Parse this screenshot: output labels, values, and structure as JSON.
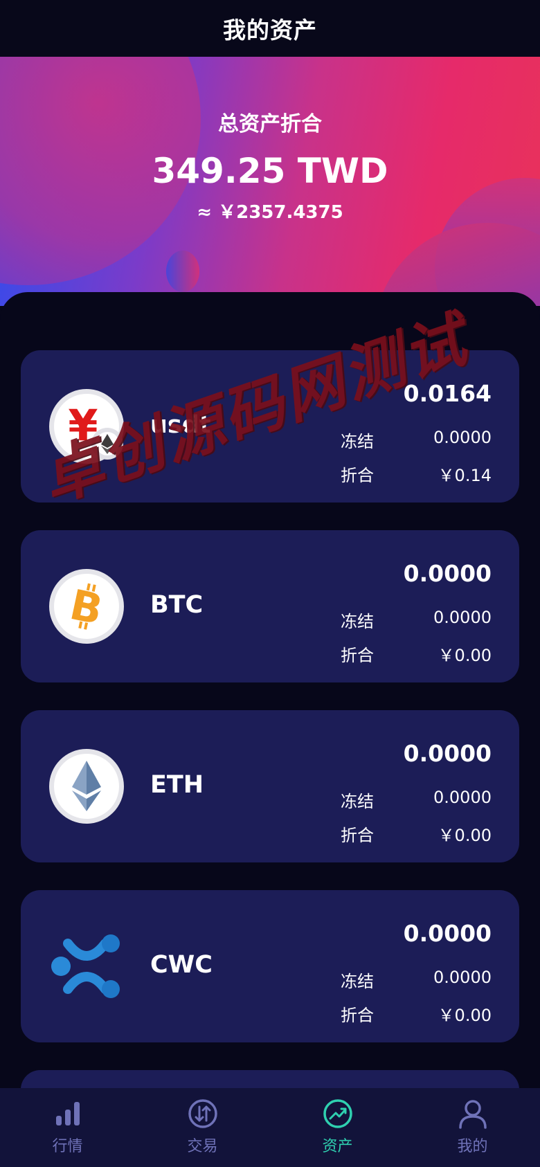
{
  "header": {
    "title": "我的资产"
  },
  "summary": {
    "label": "总资产折合",
    "total": "349.25 TWD",
    "approx": "≈ ￥2357.4375"
  },
  "assets": [
    {
      "name": "usdt",
      "amount": "0.0164",
      "frozen_label": "冻结",
      "frozen_value": "0.0000",
      "convert_label": "折合",
      "convert_value": "￥0.14",
      "icon": "usdt-yen-icon"
    },
    {
      "name": "BTC",
      "amount": "0.0000",
      "frozen_label": "冻结",
      "frozen_value": "0.0000",
      "convert_label": "折合",
      "convert_value": "￥0.00",
      "icon": "bitcoin-icon"
    },
    {
      "name": "ETH",
      "amount": "0.0000",
      "frozen_label": "冻结",
      "frozen_value": "0.0000",
      "convert_label": "折合",
      "convert_value": "￥0.00",
      "icon": "ethereum-icon"
    },
    {
      "name": "CWC",
      "amount": "0.0000",
      "frozen_label": "冻结",
      "frozen_value": "0.0000",
      "convert_label": "折合",
      "convert_value": "￥0.00",
      "icon": "ripple-icon"
    }
  ],
  "watermark": "卓创源码网测试",
  "tabbar": {
    "active": "assets",
    "items": [
      {
        "key": "market",
        "label": "行情",
        "icon": "bar-chart-icon"
      },
      {
        "key": "trade",
        "label": "交易",
        "icon": "swap-arrows-icon"
      },
      {
        "key": "assets",
        "label": "资产",
        "icon": "trend-up-icon"
      },
      {
        "key": "mine",
        "label": "我的",
        "icon": "user-icon"
      }
    ]
  },
  "colors": {
    "background": "#07071a",
    "card": "#1c1d57",
    "tab_active": "#2fd0b0",
    "tab_inactive": "#6f72b8",
    "watermark": "#7a0f1c"
  }
}
